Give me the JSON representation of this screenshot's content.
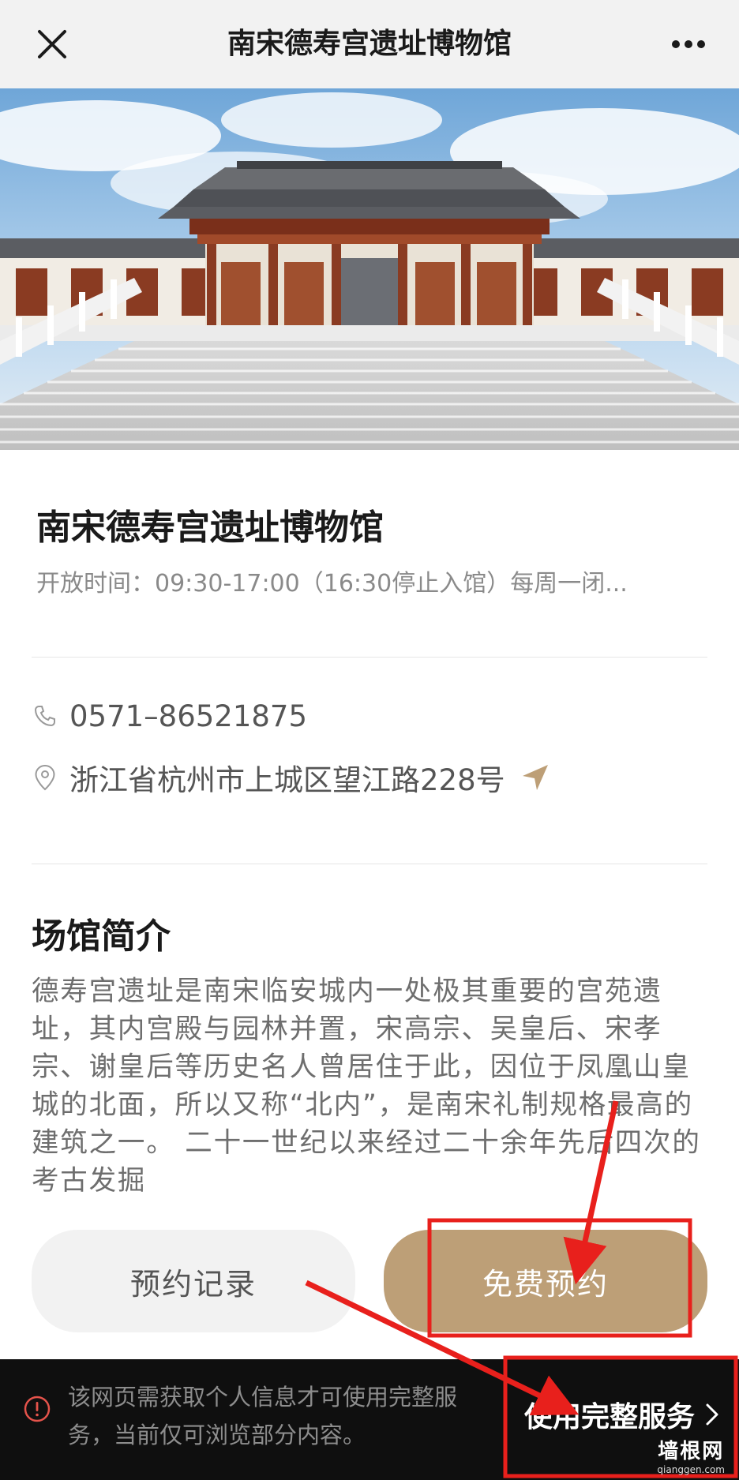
{
  "header": {
    "title": "南宋德寿宫遗址博物馆",
    "close_icon": "close-icon",
    "more_icon": "more-icon"
  },
  "hero": {
    "image_alt": "南宋德寿宫遗址博物馆正殿外景",
    "sky_color": "#9cc3e6",
    "roof_color": "#5b5d62",
    "wood_color": "#8a3b22",
    "stone_color": "#e7e7e7"
  },
  "venue": {
    "title": "南宋德寿宫遗址博物馆",
    "hours": "开放时间：09:30-17:00（16:30停止入馆）每周一闭...",
    "phone": "0571–86521875",
    "address": "浙江省杭州市上城区望江路228号",
    "phone_icon": "phone-icon",
    "location_icon": "location-pin-icon",
    "nav_icon": "navigation-arrow-icon"
  },
  "intro": {
    "heading": "场馆简介",
    "text": "德寿宫遗址是南宋临安城内一处极其重要的宫苑遗址，其内宫殿与园林并置，宋高宗、吴皇后、宋孝宗、谢皇后等历史名人曾居住于此，因位于凤凰山皇城的北面，所以又称“北内”，是南宋礼制规格最高的建筑之一。 二十一世纪以来经过二十余年先后四次的考古发掘"
  },
  "buttons": {
    "records": "预约记录",
    "reserve": "免费预约"
  },
  "notice": {
    "text": "该网页需获取个人信息才可使用完整服务，当前仅可浏览部分内容。",
    "action": "使用完整服务",
    "alert_icon": "alert-circle-icon",
    "chevron_icon": "chevron-right-icon"
  },
  "watermark": {
    "title": "墙根网",
    "url": "qianggen.com"
  },
  "colors": {
    "accent": "#bd9f77",
    "annotation_red": "#e8201c",
    "notice_bg": "#0f0f0f"
  }
}
